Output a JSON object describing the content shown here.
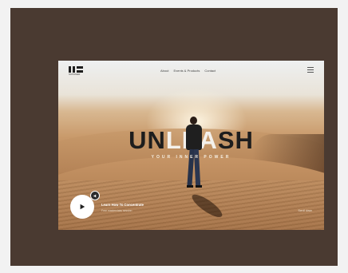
{
  "brand": {
    "sub_text": "NOHOMER"
  },
  "nav": {
    "items": [
      "About",
      "Events & Products",
      "Contact"
    ]
  },
  "hero": {
    "headline_dark_1": "UN",
    "headline_light": "LEA",
    "headline_dark_2": "SH",
    "tagline": "YOUR INNER POWER",
    "cta_title": "Learn How To Concentrate",
    "cta_sub": "Free masterclass session",
    "corner_text": "Scroll down"
  },
  "icons": {
    "play": "play-icon",
    "mini": "volume-icon",
    "menu": "hamburger-icon"
  },
  "colors": {
    "frame": "#4a3a31",
    "sand": "#b9875a",
    "headline": "#1d1d1d"
  }
}
